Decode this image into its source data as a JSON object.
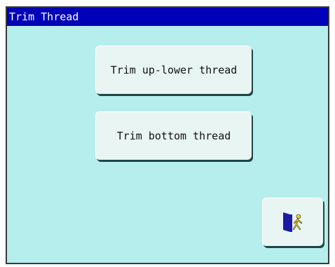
{
  "window": {
    "title": "Trim Thread"
  },
  "buttons": {
    "trim_up_lower": "Trim up-lower thread",
    "trim_bottom": "Trim bottom thread"
  },
  "exit_button": {
    "icon": "exit-door-icon"
  },
  "colors": {
    "titlebar": "#0000b8",
    "panel_background": "#b6eded",
    "button_face": "#e9f5f2",
    "button_shadow": "#1f4646",
    "icon_door": "#1a1aa6",
    "icon_person": "#e8d31a"
  }
}
